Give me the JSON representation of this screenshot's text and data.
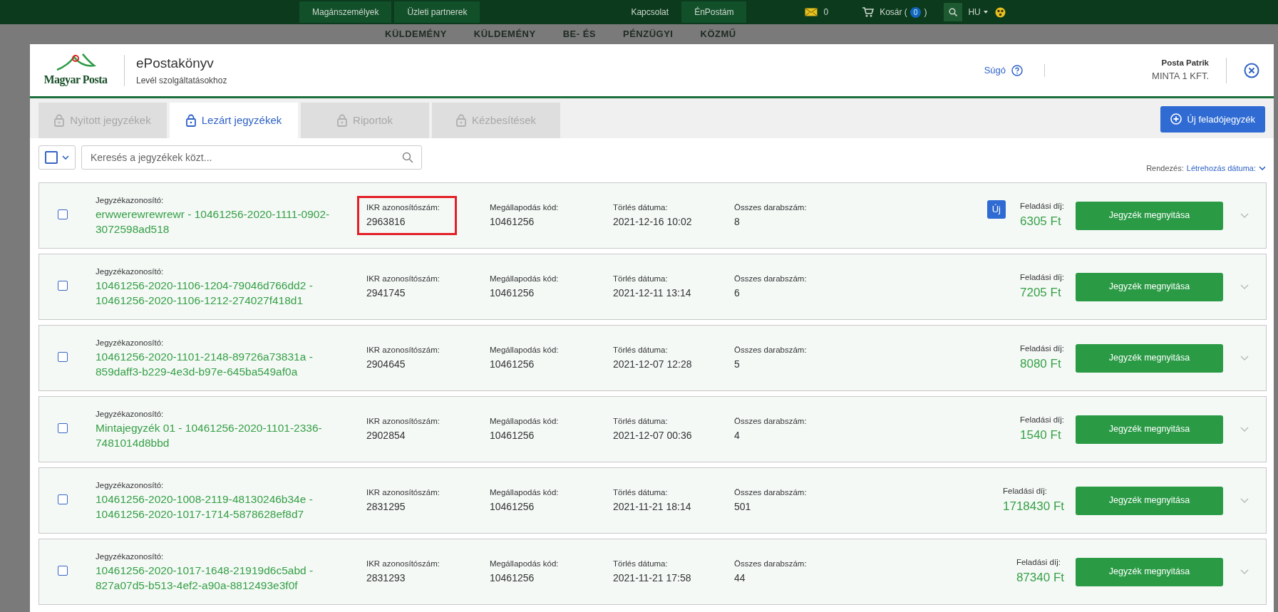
{
  "top_bar": {
    "links": [
      {
        "label": "Magánszemélyek",
        "kind": "button"
      },
      {
        "label": "Üzleti partnerek",
        "kind": "button"
      },
      {
        "label": "Kapcsolat",
        "kind": "link"
      },
      {
        "label": "ÉnPostám",
        "kind": "button"
      }
    ],
    "mail_count": "0",
    "cart_label": "Kosár (",
    "cart_count": "0",
    "cart_close": ")",
    "language": "HU"
  },
  "background_nav": [
    "KÜLDEMÉNY",
    "KÜLDEMÉNY",
    "BE- ÉS",
    "PÉNZÜGYI",
    "KÖZMŰ"
  ],
  "header": {
    "logo_text": "Magyar Posta",
    "app_title": "ePostakönyv",
    "app_subtitle": "Levél szolgáltatásokhoz",
    "help": "Súgó",
    "user_name": "Posta Patrik",
    "company": "MINTA 1 KFT."
  },
  "tabs": [
    {
      "label": "Nyitott jegyzékek",
      "selected": false
    },
    {
      "label": "Lezárt jegyzékek",
      "selected": true
    },
    {
      "label": "Riportok",
      "selected": false
    },
    {
      "label": "Kézbesítések",
      "selected": false
    }
  ],
  "new_button": "Új feladójegyzék",
  "toolbar": {
    "select_all_checked": false,
    "search_placeholder": "Keresés a jegyzékek közt...",
    "sort_label": "Rendezés:",
    "sort_value": "Létrehozás dátuma:"
  },
  "rows": [
    {
      "checked": false,
      "id_label": "Jegyzékazonosító:",
      "id": "erwwerewrewrewr - 10461256-2020-1111-0902-3072598ad518",
      "ikr_label": "IKR azonosítószám:",
      "ikr": "2963816",
      "ikr_highlighted": true,
      "code_label": "Megállapodás kód:",
      "code": "10461256",
      "deletion_label": "Törlés dátuma:",
      "deletion": "2021-12-16 10:02",
      "count_label": "Összes darabszám:",
      "count": "8",
      "badge": "Új",
      "fee_label": "Feladási díj:",
      "fee": "6305 Ft",
      "action": "Jegyzék megnyitása"
    },
    {
      "checked": false,
      "id_label": "Jegyzékazonosító:",
      "id": "10461256-2020-1106-1204-79046d766dd2 - 10461256-2020-1106-1212-274027f418d1",
      "ikr_label": "IKR azonosítószám:",
      "ikr": "2941745",
      "ikr_highlighted": false,
      "code_label": "Megállapodás kód:",
      "code": "10461256",
      "deletion_label": "Törlés dátuma:",
      "deletion": "2021-12-11 13:14",
      "count_label": "Összes darabszám:",
      "count": "6",
      "fee_label": "Feladási díj:",
      "fee": "7205 Ft",
      "action": "Jegyzék megnyitása"
    },
    {
      "checked": false,
      "id_label": "Jegyzékazonosító:",
      "id": "10461256-2020-1101-2148-89726a73831a - 859daff3-b229-4e3d-b97e-645ba549af0a",
      "ikr_label": "IKR azonosítószám:",
      "ikr": "2904645",
      "ikr_highlighted": false,
      "code_label": "Megállapodás kód:",
      "code": "10461256",
      "deletion_label": "Törlés dátuma:",
      "deletion": "2021-12-07 12:28",
      "count_label": "Összes darabszám:",
      "count": "5",
      "fee_label": "Feladási díj:",
      "fee": "8080 Ft",
      "action": "Jegyzék megnyitása"
    },
    {
      "checked": false,
      "id_label": "Jegyzékazonosító:",
      "id": "Mintajegyzék 01 - 10461256-2020-1101-2336-7481014d8bbd",
      "ikr_label": "IKR azonosítószám:",
      "ikr": "2902854",
      "ikr_highlighted": false,
      "code_label": "Megállapodás kód:",
      "code": "10461256",
      "deletion_label": "Törlés dátuma:",
      "deletion": "2021-12-07 00:36",
      "count_label": "Összes darabszám:",
      "count": "4",
      "fee_label": "Feladási díj:",
      "fee": "1540 Ft",
      "action": "Jegyzék megnyitása"
    },
    {
      "checked": false,
      "id_label": "Jegyzékazonosító:",
      "id": "10461256-2020-1008-2119-48130246b34e - 10461256-2020-1017-1714-5878628ef8d7",
      "ikr_label": "IKR azonosítószám:",
      "ikr": "2831295",
      "ikr_highlighted": false,
      "code_label": "Megállapodás kód:",
      "code": "10461256",
      "deletion_label": "Törlés dátuma:",
      "deletion": "2021-11-21 18:14",
      "count_label": "Összes darabszám:",
      "count": "501",
      "fee_label": "Feladási díj:",
      "fee": "1718430 Ft",
      "action": "Jegyzék megnyitása"
    },
    {
      "checked": false,
      "id_label": "Jegyzékazonosító:",
      "id": "10461256-2020-1017-1648-21919d6c5abd - 827a07d5-b513-4ef2-a90a-8812493e3f0f",
      "ikr_label": "IKR azonosítószám:",
      "ikr": "2831293",
      "ikr_highlighted": false,
      "code_label": "Megállapodás kód:",
      "code": "10461256",
      "deletion_label": "Törlés dátuma:",
      "deletion": "2021-11-21 17:58",
      "count_label": "Összes darabszám:",
      "count": "44",
      "fee_label": "Feladási díj:",
      "fee": "87340 Ft",
      "action": "Jegyzék megnyitása"
    }
  ]
}
